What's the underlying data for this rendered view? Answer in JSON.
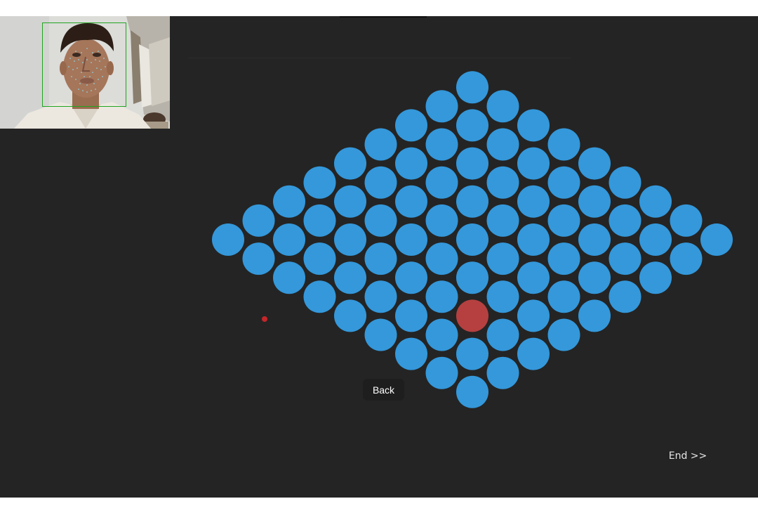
{
  "controls": {
    "back_label": "Back",
    "end_label": "End >>"
  },
  "calibration_grid": {
    "rows": 9,
    "cols": 9,
    "active_point": {
      "row": 6,
      "col": 2
    },
    "dot_color": "#3498db",
    "active_color": "#b64040"
  },
  "gaze_marker": {
    "color": "#c3262a"
  },
  "webcam": {
    "face_box_color": "#1fa51f",
    "mesh_color": "#7ec8d8"
  },
  "theme": {
    "background": "#242424",
    "button_background": "#1e1e1e"
  }
}
